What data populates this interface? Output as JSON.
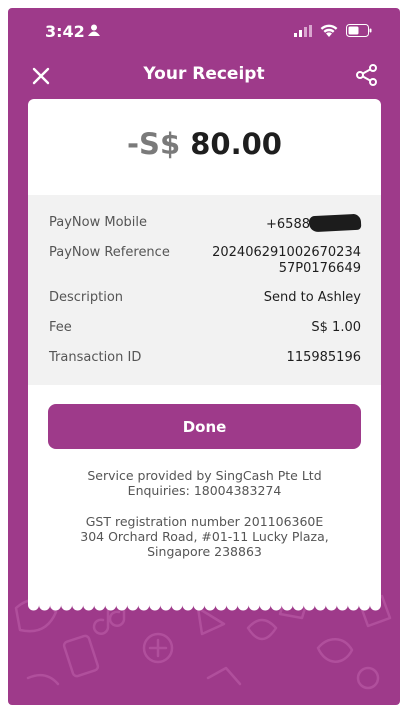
{
  "status_bar": {
    "time": "3:42",
    "icons": [
      "person-icon",
      "signal-icon",
      "wifi-icon",
      "battery-icon"
    ]
  },
  "nav": {
    "title": "Your Receipt",
    "close_icon": "close-icon",
    "share_icon": "share-icon"
  },
  "receipt": {
    "amount_currency": "-S$",
    "amount_value": "80.00",
    "rows": [
      {
        "label": "PayNow Mobile",
        "value": "+6588"
      },
      {
        "label": "PayNow Reference",
        "value_line1": "202406291002670234",
        "value_line2": "57P0176649"
      },
      {
        "label": "Description",
        "value": "Send to Ashley"
      },
      {
        "label": "Fee",
        "value": "S$ 1.00"
      },
      {
        "label": "Transaction ID",
        "value": "115985196"
      }
    ],
    "done_label": "Done",
    "provider_line1": "Service provided by SingCash Pte Ltd",
    "provider_line2": "Enquiries: 18004383274",
    "gst_line1": "GST registration number 201106360E",
    "gst_line2": "304 Orchard Road, #01-11 Lucky Plaza,",
    "gst_line3": "Singapore 238863"
  },
  "colors": {
    "brand": "#9e3a8a",
    "card": "#ffffff",
    "details_bg": "#f2f2f2"
  }
}
